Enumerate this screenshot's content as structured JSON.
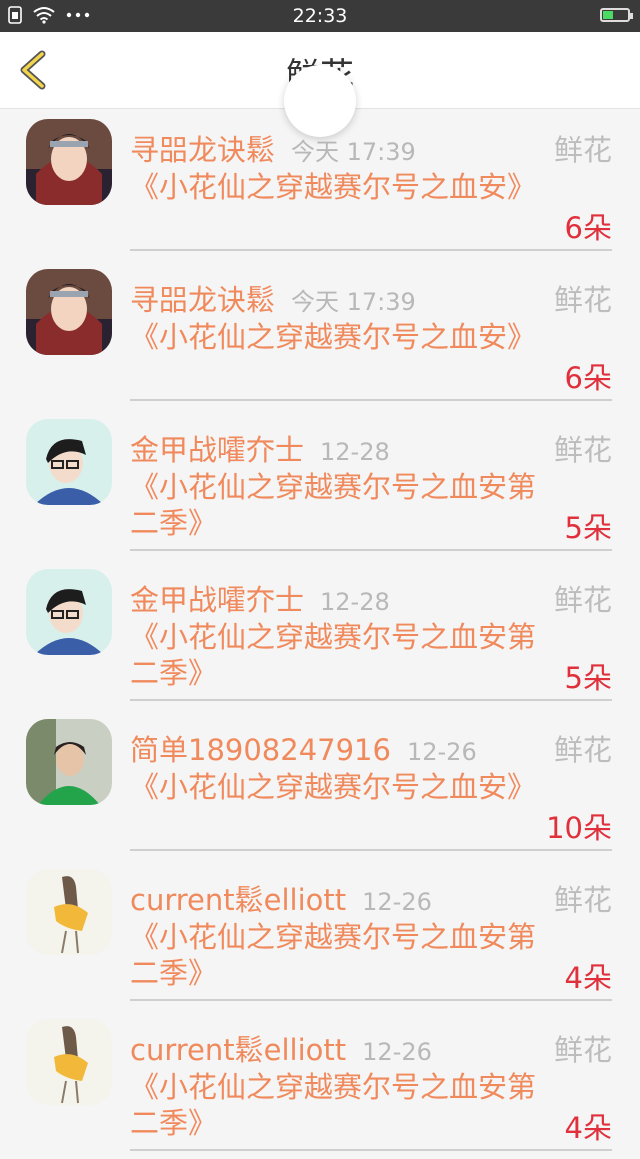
{
  "status_bar": {
    "time": "22:33",
    "icons": [
      "sim-icon",
      "wifi-icon",
      "more-dots-icon",
      "battery-charging-icon"
    ]
  },
  "nav": {
    "back_icon": "chevron-left-icon",
    "title": "鲜花"
  },
  "colors": {
    "accent_orange": "#f08a5d",
    "count_red": "#e0303c",
    "gray_text": "#b8b8b8"
  },
  "items": [
    {
      "name": "寻㗊龙诀鬆",
      "time": "今天 17:39",
      "kind": "鲜花",
      "book": "《小花仙之穿越赛尔号之血安》",
      "count": "6朵",
      "avatar": "anime-character-avatar"
    },
    {
      "name": "寻㗊龙诀鬆",
      "time": "今天 17:39",
      "kind": "鲜花",
      "book": "《小花仙之穿越赛尔号之血安》",
      "count": "6朵",
      "avatar": "anime-character-avatar"
    },
    {
      "name": "金甲战嚯夰士",
      "time": "12-28",
      "kind": "鲜花",
      "book": "《小花仙之穿越赛尔号之血安第二季》",
      "count": "5朵",
      "avatar": "boy-with-glasses-avatar"
    },
    {
      "name": "金甲战嚯夰士",
      "time": "12-28",
      "kind": "鲜花",
      "book": "《小花仙之穿越赛尔号之血安第二季》",
      "count": "5朵",
      "avatar": "boy-with-glasses-avatar"
    },
    {
      "name": "简单18908247916",
      "time": "12-26",
      "kind": "鲜花",
      "book": "《小花仙之穿越赛尔号之血安》",
      "count": "10朵",
      "avatar": "woman-photo-avatar"
    },
    {
      "name": "current鬆elliott",
      "time": "12-26",
      "kind": "鲜花",
      "book": "《小花仙之穿越赛尔号之血安第二季》",
      "count": "4朵",
      "avatar": "sketch-figure-avatar"
    },
    {
      "name": "current鬆elliott",
      "time": "12-26",
      "kind": "鲜花",
      "book": "《小花仙之穿越赛尔号之血安第二季》",
      "count": "4朵",
      "avatar": "sketch-figure-avatar"
    }
  ]
}
